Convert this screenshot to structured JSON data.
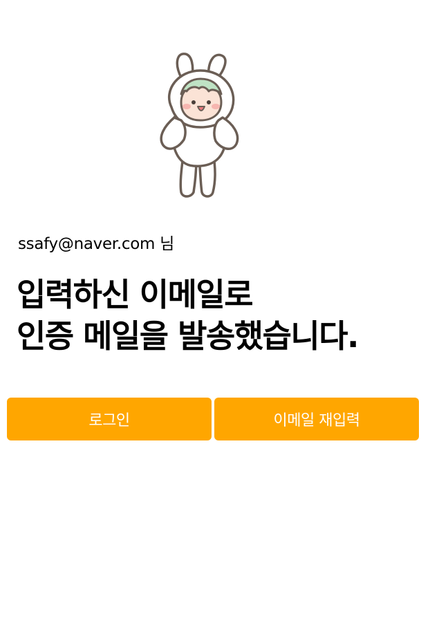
{
  "mascot": {
    "icon": "rabbit-mascot-icon"
  },
  "user": {
    "email": "ssafy@naver.com",
    "suffix": "님"
  },
  "headline": {
    "line1": "입력하신 이메일로",
    "line2": "인증 메일을 발송했습니다."
  },
  "buttons": {
    "login_label": "로그인",
    "reenter_label": "이메일 재입력"
  },
  "colors": {
    "accent": "#FFA600",
    "button_text": "#FFFFFF",
    "mascot_outline": "#6B5E55",
    "mascot_leaf": "#BFE3C4",
    "mascot_cheek": "#F6B6B0",
    "mascot_face": "#FBE3D6"
  }
}
